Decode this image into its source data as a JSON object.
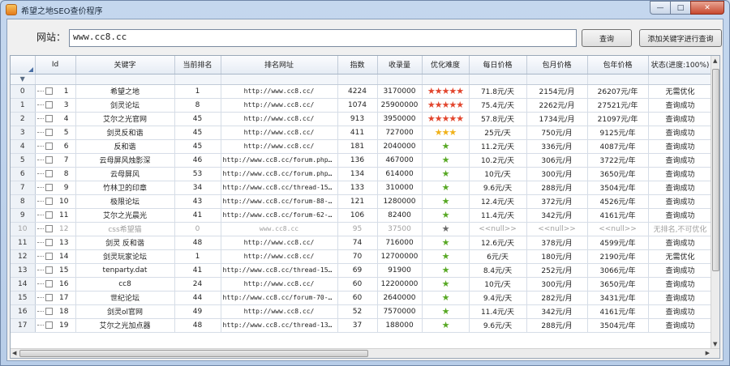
{
  "window": {
    "title": "希望之地SEO查价程序",
    "controls": {
      "minimize": "—",
      "maximize": "□",
      "close": "✕"
    }
  },
  "toolbar": {
    "site_label": "网站：",
    "site_value": "www.cc8.cc",
    "query_button": "查询",
    "add_keyword_button": "添加关键字进行查询"
  },
  "grid": {
    "columns": [
      "Id",
      "关键字",
      "当前排名",
      "排名网址",
      "指数",
      "收录量",
      "优化难度",
      "每日价格",
      "包月价格",
      "包年价格",
      "状态(进度:100%)"
    ],
    "rows": [
      {
        "index": "0",
        "id": "1",
        "keyword": "希望之地",
        "rank": "1",
        "url": "http://www.cc8.cc/",
        "index_val": "4224",
        "indexed": "3170000",
        "difficulty": 5,
        "star_color": "red",
        "daily": "71.8元/天",
        "monthly": "2154元/月",
        "yearly": "26207元/年",
        "status": "无需优化",
        "disabled": false
      },
      {
        "index": "1",
        "id": "3",
        "keyword": "剑灵论坛",
        "rank": "8",
        "url": "http://www.cc8.cc/",
        "index_val": "1074",
        "indexed": "25900000",
        "difficulty": 5,
        "star_color": "red",
        "daily": "75.4元/天",
        "monthly": "2262元/月",
        "yearly": "27521元/年",
        "status": "查询成功",
        "disabled": false
      },
      {
        "index": "2",
        "id": "4",
        "keyword": "艾尔之光官网",
        "rank": "45",
        "url": "http://www.cc8.cc/",
        "index_val": "913",
        "indexed": "3950000",
        "difficulty": 5,
        "star_color": "red",
        "daily": "57.8元/天",
        "monthly": "1734元/月",
        "yearly": "21097元/年",
        "status": "查询成功",
        "disabled": false
      },
      {
        "index": "3",
        "id": "5",
        "keyword": "剑灵反和谐",
        "rank": "45",
        "url": "http://www.cc8.cc/",
        "index_val": "411",
        "indexed": "727000",
        "difficulty": 3,
        "star_color": "gold",
        "daily": "25元/天",
        "monthly": "750元/月",
        "yearly": "9125元/年",
        "status": "查询成功",
        "disabled": false
      },
      {
        "index": "4",
        "id": "6",
        "keyword": "反和谐",
        "rank": "45",
        "url": "http://www.cc8.cc/",
        "index_val": "181",
        "indexed": "2040000",
        "difficulty": 1,
        "star_color": "green",
        "daily": "11.2元/天",
        "monthly": "336元/月",
        "yearly": "4087元/年",
        "status": "查询成功",
        "disabled": false
      },
      {
        "index": "5",
        "id": "7",
        "keyword": "云母屏风烛影深",
        "rank": "46",
        "url": "http://www.cc8.cc/forum.php?m...",
        "index_val": "136",
        "indexed": "467000",
        "difficulty": 1,
        "star_color": "green",
        "daily": "10.2元/天",
        "monthly": "306元/月",
        "yearly": "3722元/年",
        "status": "查询成功",
        "disabled": false
      },
      {
        "index": "6",
        "id": "8",
        "keyword": "云母屏风",
        "rank": "53",
        "url": "http://www.cc8.cc/forum.php?m...",
        "index_val": "134",
        "indexed": "614000",
        "difficulty": 1,
        "star_color": "green",
        "daily": "10元/天",
        "monthly": "300元/月",
        "yearly": "3650元/年",
        "status": "查询成功",
        "disabled": false
      },
      {
        "index": "7",
        "id": "9",
        "keyword": "竹林卫的印章",
        "rank": "34",
        "url": "http://www.cc8.cc/thread-1581...",
        "index_val": "133",
        "indexed": "310000",
        "difficulty": 1,
        "star_color": "green",
        "daily": "9.6元/天",
        "monthly": "288元/月",
        "yearly": "3504元/年",
        "status": "查询成功",
        "disabled": false
      },
      {
        "index": "8",
        "id": "10",
        "keyword": "极限论坛",
        "rank": "43",
        "url": "http://www.cc8.cc/forum-88-1...",
        "index_val": "121",
        "indexed": "1280000",
        "difficulty": 1,
        "star_color": "green",
        "daily": "12.4元/天",
        "monthly": "372元/月",
        "yearly": "4526元/年",
        "status": "查询成功",
        "disabled": false
      },
      {
        "index": "9",
        "id": "11",
        "keyword": "艾尔之光晨光",
        "rank": "41",
        "url": "http://www.cc8.cc/forum-62-1...",
        "index_val": "106",
        "indexed": "82400",
        "difficulty": 1,
        "star_color": "green",
        "daily": "11.4元/天",
        "monthly": "342元/月",
        "yearly": "4161元/年",
        "status": "查询成功",
        "disabled": false
      },
      {
        "index": "10",
        "id": "12",
        "keyword": "css希望猫",
        "rank": "0",
        "url": "www.cc8.cc",
        "index_val": "95",
        "indexed": "37500",
        "difficulty": 1,
        "star_color": "gray",
        "daily": "<<null>>",
        "monthly": "<<null>>",
        "yearly": "<<null>>",
        "status": "无排名,不可优化",
        "disabled": true
      },
      {
        "index": "11",
        "id": "13",
        "keyword": "剑灵 反和谐",
        "rank": "48",
        "url": "http://www.cc8.cc/",
        "index_val": "74",
        "indexed": "716000",
        "difficulty": 1,
        "star_color": "green",
        "daily": "12.6元/天",
        "monthly": "378元/月",
        "yearly": "4599元/年",
        "status": "查询成功",
        "disabled": false
      },
      {
        "index": "12",
        "id": "14",
        "keyword": "剑灵玩家论坛",
        "rank": "1",
        "url": "http://www.cc8.cc/",
        "index_val": "70",
        "indexed": "12700000",
        "difficulty": 1,
        "star_color": "green",
        "daily": "6元/天",
        "monthly": "180元/月",
        "yearly": "2190元/年",
        "status": "无需优化",
        "disabled": false
      },
      {
        "index": "13",
        "id": "15",
        "keyword": "tenparty.dat",
        "rank": "41",
        "url": "http://www.cc8.cc/thread-1517...",
        "index_val": "69",
        "indexed": "91900",
        "difficulty": 1,
        "star_color": "green",
        "daily": "8.4元/天",
        "monthly": "252元/月",
        "yearly": "3066元/年",
        "status": "查询成功",
        "disabled": false
      },
      {
        "index": "14",
        "id": "16",
        "keyword": "cc8",
        "rank": "24",
        "url": "http://www.cc8.cc/",
        "index_val": "60",
        "indexed": "12200000",
        "difficulty": 1,
        "star_color": "green",
        "daily": "10元/天",
        "monthly": "300元/月",
        "yearly": "3650元/年",
        "status": "查询成功",
        "disabled": false
      },
      {
        "index": "15",
        "id": "17",
        "keyword": "世纪论坛",
        "rank": "44",
        "url": "http://www.cc8.cc/forum-70-1...",
        "index_val": "60",
        "indexed": "2640000",
        "difficulty": 1,
        "star_color": "green",
        "daily": "9.4元/天",
        "monthly": "282元/月",
        "yearly": "3431元/年",
        "status": "查询成功",
        "disabled": false
      },
      {
        "index": "16",
        "id": "18",
        "keyword": "剑灵ol官网",
        "rank": "49",
        "url": "http://www.cc8.cc/",
        "index_val": "52",
        "indexed": "7570000",
        "difficulty": 1,
        "star_color": "green",
        "daily": "11.4元/天",
        "monthly": "342元/月",
        "yearly": "4161元/年",
        "status": "查询成功",
        "disabled": false
      },
      {
        "index": "17",
        "id": "19",
        "keyword": "艾尔之光加点器",
        "rank": "48",
        "url": "http://www.cc8.cc/thread-1371...",
        "index_val": "37",
        "indexed": "188000",
        "difficulty": 1,
        "star_color": "green",
        "daily": "9.6元/天",
        "monthly": "288元/月",
        "yearly": "3504元/年",
        "status": "查询成功",
        "disabled": false
      }
    ]
  },
  "colors": {
    "accent": "#4a6fa5",
    "star_red": "#e2462e",
    "star_gold": "#f0b21a",
    "star_green": "#57a823",
    "star_gray": "#6a6a6a"
  }
}
